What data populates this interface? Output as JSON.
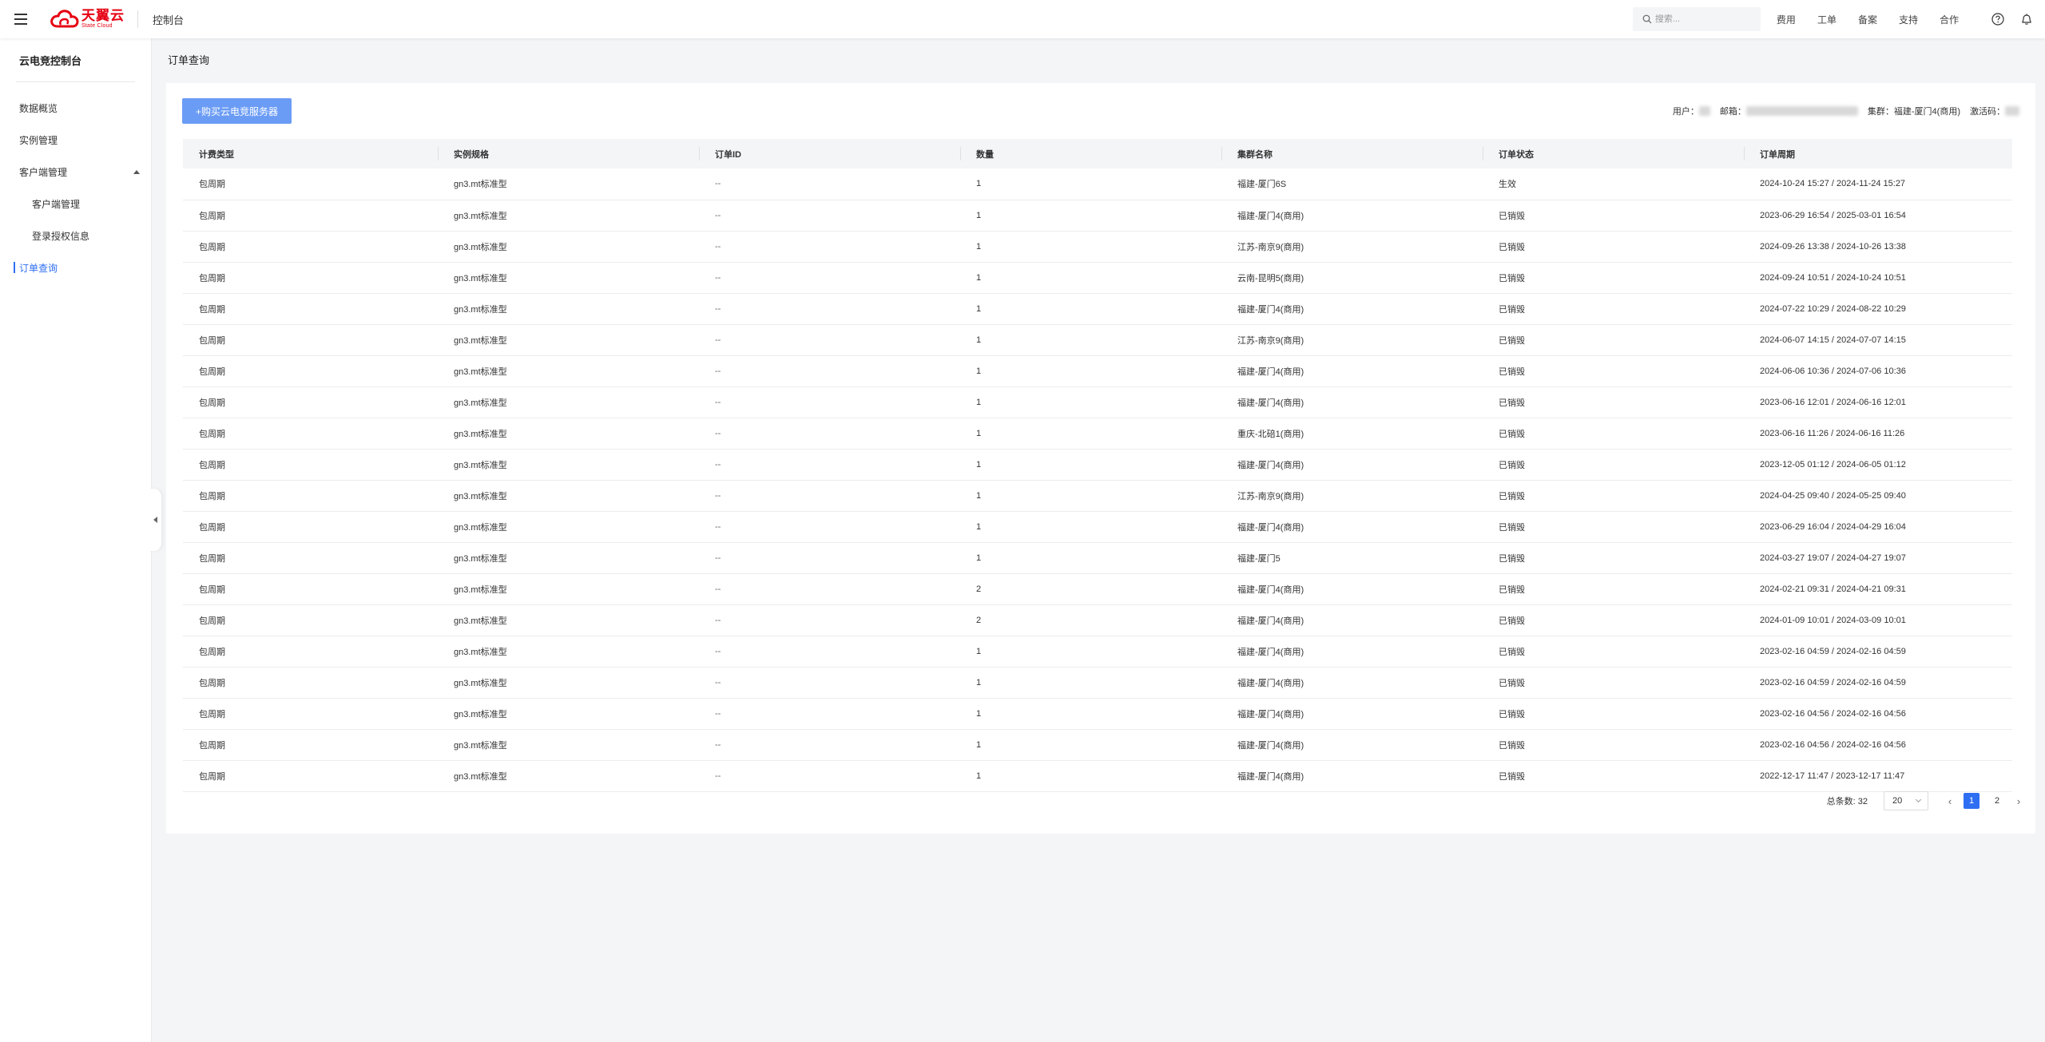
{
  "header": {
    "logo_cn": "天翼云",
    "logo_en": "State Cloud",
    "console_title": "控制台",
    "search_placeholder": "搜索...",
    "links": [
      "费用",
      "工单",
      "备案",
      "支持",
      "合作"
    ]
  },
  "sidebar": {
    "title": "云电竞控制台",
    "items": [
      {
        "label": "数据概览"
      },
      {
        "label": "实例管理"
      },
      {
        "label": "客户端管理"
      },
      {
        "label": "客户端管理"
      },
      {
        "label": "登录授权信息"
      },
      {
        "label": "订单查询"
      }
    ]
  },
  "main": {
    "breadcrumb": "订单查询",
    "buy_button": "+购买云电竞服务器",
    "user_label": "用户：",
    "email_label": "邮箱：",
    "cluster_label": "集群：福建-厦门4(商用)",
    "activation_label": "激活码："
  },
  "table": {
    "columns": [
      "计费类型",
      "实例规格",
      "订单ID",
      "数量",
      "集群名称",
      "订单状态",
      "订单周期"
    ],
    "rows": [
      [
        "包周期",
        "gn3.mt标准型",
        "--",
        "1",
        "福建-厦门6S",
        "生效",
        "2024-10-24 15:27 / 2024-11-24 15:27"
      ],
      [
        "包周期",
        "gn3.mt标准型",
        "--",
        "1",
        "福建-厦门4(商用)",
        "已销毁",
        "2023-06-29 16:54 / 2025-03-01 16:54"
      ],
      [
        "包周期",
        "gn3.mt标准型",
        "--",
        "1",
        "江苏-南京9(商用)",
        "已销毁",
        "2024-09-26 13:38 / 2024-10-26 13:38"
      ],
      [
        "包周期",
        "gn3.mt标准型",
        "--",
        "1",
        "云南-昆明5(商用)",
        "已销毁",
        "2024-09-24 10:51 / 2024-10-24 10:51"
      ],
      [
        "包周期",
        "gn3.mt标准型",
        "--",
        "1",
        "福建-厦门4(商用)",
        "已销毁",
        "2024-07-22 10:29 / 2024-08-22 10:29"
      ],
      [
        "包周期",
        "gn3.mt标准型",
        "--",
        "1",
        "江苏-南京9(商用)",
        "已销毁",
        "2024-06-07 14:15 / 2024-07-07 14:15"
      ],
      [
        "包周期",
        "gn3.mt标准型",
        "--",
        "1",
        "福建-厦门4(商用)",
        "已销毁",
        "2024-06-06 10:36 / 2024-07-06 10:36"
      ],
      [
        "包周期",
        "gn3.mt标准型",
        "--",
        "1",
        "福建-厦门4(商用)",
        "已销毁",
        "2023-06-16 12:01 / 2024-06-16 12:01"
      ],
      [
        "包周期",
        "gn3.mt标准型",
        "--",
        "1",
        "重庆-北碚1(商用)",
        "已销毁",
        "2023-06-16 11:26 / 2024-06-16 11:26"
      ],
      [
        "包周期",
        "gn3.mt标准型",
        "--",
        "1",
        "福建-厦门4(商用)",
        "已销毁",
        "2023-12-05 01:12 / 2024-06-05 01:12"
      ],
      [
        "包周期",
        "gn3.mt标准型",
        "--",
        "1",
        "江苏-南京9(商用)",
        "已销毁",
        "2024-04-25 09:40 / 2024-05-25 09:40"
      ],
      [
        "包周期",
        "gn3.mt标准型",
        "--",
        "1",
        "福建-厦门4(商用)",
        "已销毁",
        "2023-06-29 16:04 / 2024-04-29 16:04"
      ],
      [
        "包周期",
        "gn3.mt标准型",
        "--",
        "1",
        "福建-厦门5",
        "已销毁",
        "2024-03-27 19:07 / 2024-04-27 19:07"
      ],
      [
        "包周期",
        "gn3.mt标准型",
        "--",
        "2",
        "福建-厦门4(商用)",
        "已销毁",
        "2024-02-21 09:31 / 2024-04-21 09:31"
      ],
      [
        "包周期",
        "gn3.mt标准型",
        "--",
        "2",
        "福建-厦门4(商用)",
        "已销毁",
        "2024-01-09 10:01 / 2024-03-09 10:01"
      ],
      [
        "包周期",
        "gn3.mt标准型",
        "--",
        "1",
        "福建-厦门4(商用)",
        "已销毁",
        "2023-02-16 04:59 / 2024-02-16 04:59"
      ],
      [
        "包周期",
        "gn3.mt标准型",
        "--",
        "1",
        "福建-厦门4(商用)",
        "已销毁",
        "2023-02-16 04:59 / 2024-02-16 04:59"
      ],
      [
        "包周期",
        "gn3.mt标准型",
        "--",
        "1",
        "福建-厦门4(商用)",
        "已销毁",
        "2023-02-16 04:56 / 2024-02-16 04:56"
      ],
      [
        "包周期",
        "gn3.mt标准型",
        "--",
        "1",
        "福建-厦门4(商用)",
        "已销毁",
        "2023-02-16 04:56 / 2024-02-16 04:56"
      ],
      [
        "包周期",
        "gn3.mt标准型",
        "--",
        "1",
        "福建-厦门4(商用)",
        "已销毁",
        "2022-12-17 11:47 / 2023-12-17 11:47"
      ]
    ]
  },
  "pagination": {
    "total_label": "总条数:",
    "total": "32",
    "page_size": "20",
    "pages": [
      "1",
      "2"
    ],
    "current_page": "1"
  },
  "colors": {
    "accent": "#2e6ef2",
    "buy_button": "#6b9cf5",
    "brand_red": "#e60012"
  },
  "icons": {
    "menu": "hamburger-icon",
    "search": "search-icon",
    "help": "help-circle-icon",
    "notifications": "bell-icon",
    "collapse": "caret-left-icon"
  }
}
